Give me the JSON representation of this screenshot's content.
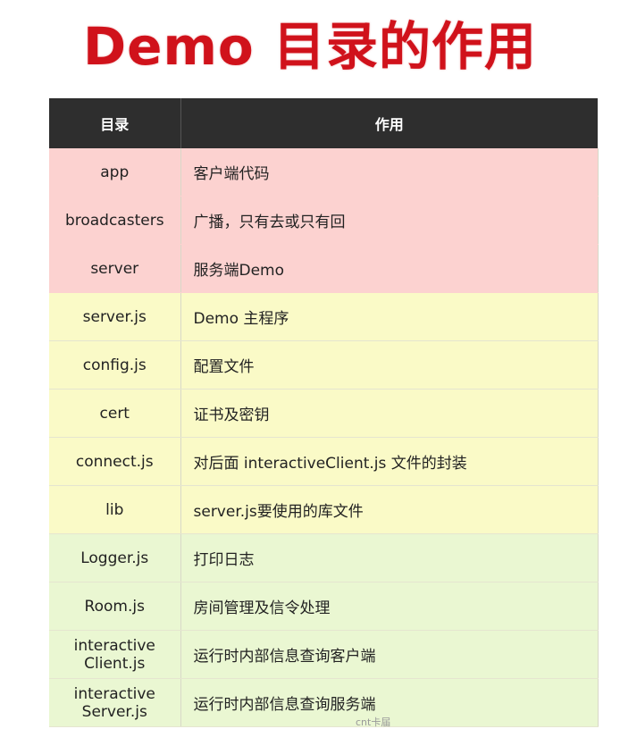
{
  "title": "Demo 目录的作用",
  "table": {
    "headers": [
      "目录",
      "作用"
    ],
    "rows": [
      {
        "name": "app",
        "desc": "客户端代码",
        "group": "red"
      },
      {
        "name": "broadcasters",
        "desc": "广播，只有去或只有回",
        "group": "red"
      },
      {
        "name": "server",
        "desc": "服务端Demo",
        "group": "red"
      },
      {
        "name": "server.js",
        "desc": "Demo 主程序",
        "group": "yellow"
      },
      {
        "name": "config.js",
        "desc": "配置文件",
        "group": "yellow"
      },
      {
        "name": "cert",
        "desc": "证书及密钥",
        "group": "yellow"
      },
      {
        "name": "connect.js",
        "desc": "对后面 interactiveClient.js 文件的封装",
        "group": "yellow"
      },
      {
        "name": "lib",
        "desc": "server.js要使用的库文件",
        "group": "yellow"
      },
      {
        "name": "Logger.js",
        "desc": "打印日志",
        "group": "green"
      },
      {
        "name": "Room.js",
        "desc": "房间管理及信令处理",
        "group": "green"
      },
      {
        "name": "interactive\nClient.js",
        "desc": "运行时内部信息查询客户端",
        "group": "green"
      },
      {
        "name": "interactive\nServer.js",
        "desc": "运行时内部信息查询服务端",
        "group": "green"
      }
    ]
  },
  "colors": {
    "title": "#d0121b",
    "header_bg": "#2e2e2e",
    "red_group": "#fcd2d0",
    "yellow_group": "#fafac7",
    "green_group": "#eaf7d2"
  },
  "footer": "cnt卡届"
}
